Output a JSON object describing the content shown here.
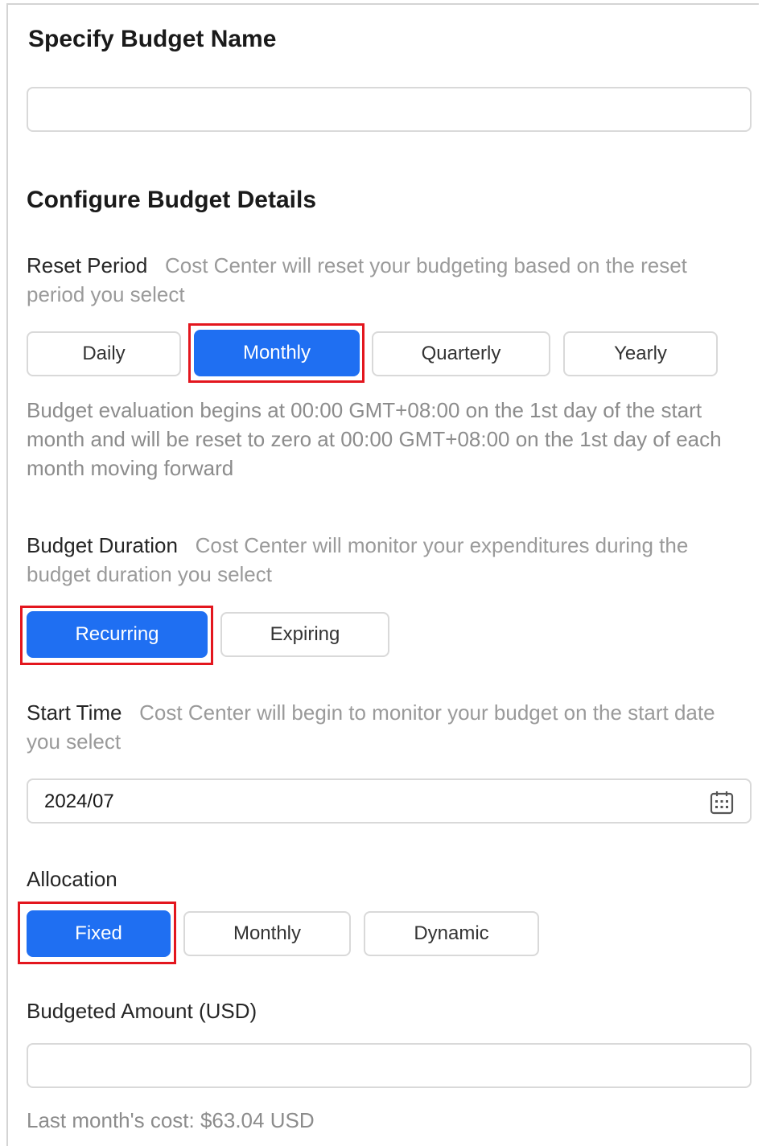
{
  "budget_name": {
    "title": "Specify Budget Name",
    "value": ""
  },
  "budget_details": {
    "title": "Configure Budget Details"
  },
  "reset_period": {
    "label": "Reset Period",
    "hint": "Cost Center will reset your budgeting based on the reset period you select",
    "options": [
      "Daily",
      "Monthly",
      "Quarterly",
      "Yearly"
    ],
    "selected": "Monthly",
    "description": "Budget evaluation begins at 00:00 GMT+08:00 on the 1st day of the start month and will be reset to zero at 00:00 GMT+08:00 on the 1st day of each month moving forward"
  },
  "budget_duration": {
    "label": "Budget Duration",
    "hint": "Cost Center will monitor your expenditures during the budget duration you select",
    "options": [
      "Recurring",
      "Expiring"
    ],
    "selected": "Recurring"
  },
  "start_time": {
    "label": "Start Time",
    "hint": "Cost Center will begin to monitor your budget on the start date you select",
    "value": "2024/07",
    "icon": "calendar-icon"
  },
  "allocation": {
    "label": "Allocation",
    "options": [
      "Fixed",
      "Monthly",
      "Dynamic"
    ],
    "selected": "Fixed"
  },
  "budgeted_amount": {
    "label": "Budgeted Amount (USD)",
    "value": "",
    "last_month_cost": "Last month's cost: $63.04 USD"
  },
  "colors": {
    "accent": "#1f6ff2",
    "highlight": "#e3161e",
    "hint_text": "#9a9a9a"
  }
}
